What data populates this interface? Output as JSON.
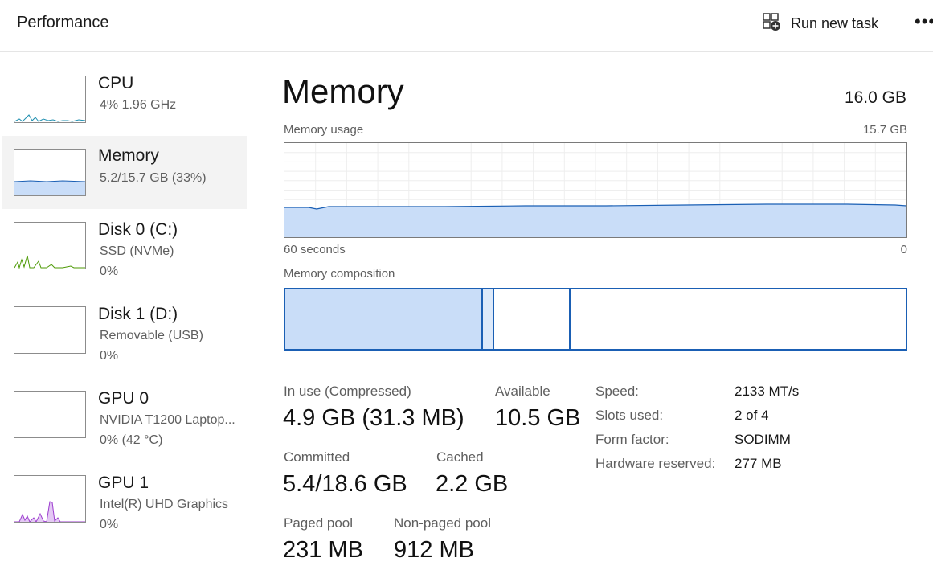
{
  "header": {
    "title": "Performance",
    "run_task_label": "Run new task",
    "more_label": "•••"
  },
  "sidebar": {
    "items": [
      {
        "name": "CPU",
        "sub1": "4%  1.96 GHz",
        "sub2": ""
      },
      {
        "name": "Memory",
        "sub1": "5.2/15.7 GB (33%)",
        "sub2": ""
      },
      {
        "name": "Disk 0 (C:)",
        "sub1": "SSD (NVMe)",
        "sub2": "0%"
      },
      {
        "name": "Disk 1 (D:)",
        "sub1": "Removable (USB)",
        "sub2": "0%"
      },
      {
        "name": "GPU 0",
        "sub1": "NVIDIA T1200 Laptop...",
        "sub2": "0%  (42 °C)"
      },
      {
        "name": "GPU 1",
        "sub1": "Intel(R) UHD Graphics",
        "sub2": "0%"
      }
    ]
  },
  "main": {
    "title": "Memory",
    "total": "16.0 GB",
    "usage_label": "Memory usage",
    "usage_max": "15.7 GB",
    "time_left": "60 seconds",
    "time_right": "0",
    "composition_label": "Memory composition",
    "in_use_label": "In use (Compressed)",
    "in_use_value": "4.9 GB (31.3 MB)",
    "available_label": "Available",
    "available_value": "10.5 GB",
    "committed_label": "Committed",
    "committed_value": "5.4/18.6 GB",
    "cached_label": "Cached",
    "cached_value": "2.2 GB",
    "paged_label": "Paged pool",
    "paged_value": "231 MB",
    "nonpaged_label": "Non-paged pool",
    "nonpaged_value": "912 MB",
    "details": [
      {
        "label": "Speed:",
        "value": "2133 MT/s"
      },
      {
        "label": "Slots used:",
        "value": "2 of 4"
      },
      {
        "label": "Form factor:",
        "value": "SODIMM"
      },
      {
        "label": "Hardware reserved:",
        "value": "277 MB"
      }
    ]
  },
  "colors": {
    "memory_fill": "#c9ddf8",
    "memory_line": "#1a5fb4",
    "cpu_line": "#1f8fb0",
    "disk_line": "#4e9a06",
    "gpu1_line": "#9c3dcf",
    "gpu1_fill": "#e4c8f4"
  },
  "icons": {
    "run_task": "new-task-icon",
    "more": "more-horizontal-icon"
  }
}
